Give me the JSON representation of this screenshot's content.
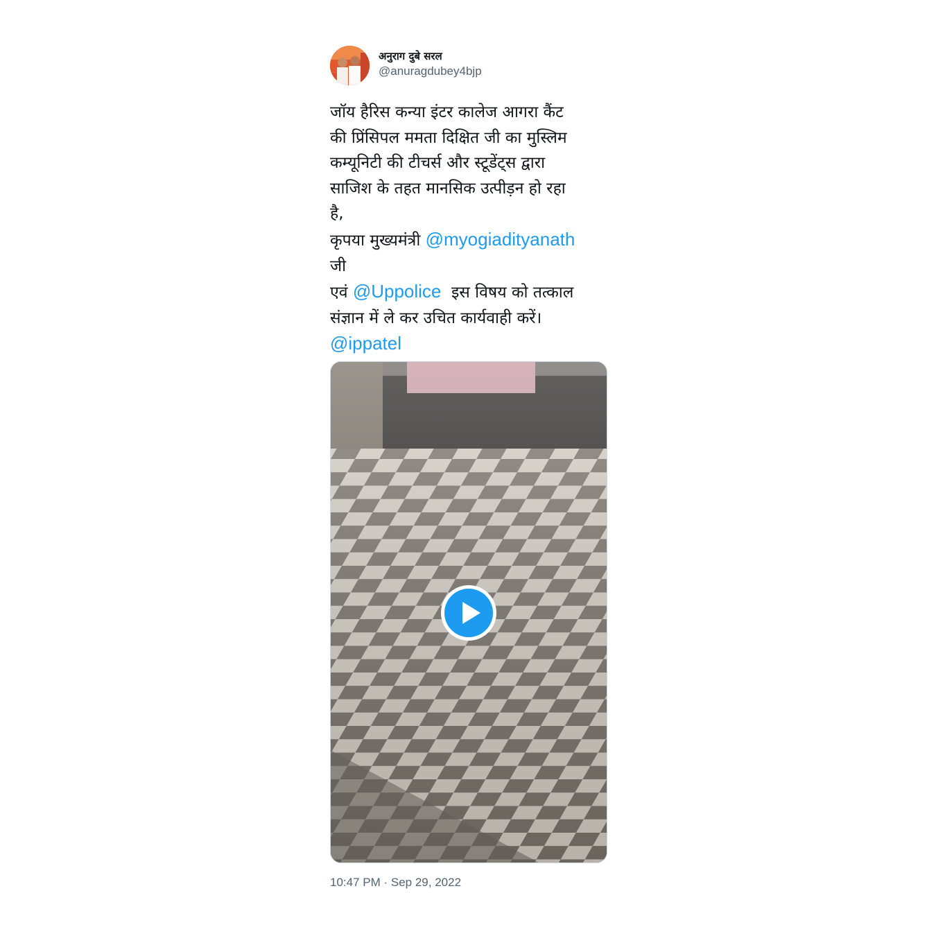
{
  "author": {
    "display_name": "अनुराग दुबे सरल",
    "handle": "@anuragdubey4bjp",
    "avatar_icon": "profile-photo"
  },
  "tweet": {
    "line1": "जॉय हैरिस कन्या इंटर कालेज आगरा कैंट",
    "line2": "की प्रिंसिपल ममता दिक्षित जी का मुस्लिम",
    "line3": "कम्यूनिटी की टीचर्स और स्टूडेंट्स द्वारा",
    "line4": "साजिश के तहत मानसिक उत्पीड़न हो रहा",
    "line5": "है,",
    "line6_prefix": "कृपया मुख्यमंत्री ",
    "mention1": "@myogiadityanath",
    "line7": "जी",
    "line8_prefix": "एवं ",
    "mention2": "@Uppolice",
    "line8_suffix": "  इस विषय को तत्काल",
    "line9": "संज्ञान में ले कर उचित कार्यवाही करें।",
    "mention3": "@ippatel"
  },
  "media": {
    "type": "video",
    "play_icon": "play-icon"
  },
  "timestamp": "10:47 PM · Sep 29, 2022",
  "colors": {
    "link": "#1d9bf0",
    "text": "#0f1419",
    "secondary": "#536471",
    "border": "#cfd9de"
  }
}
